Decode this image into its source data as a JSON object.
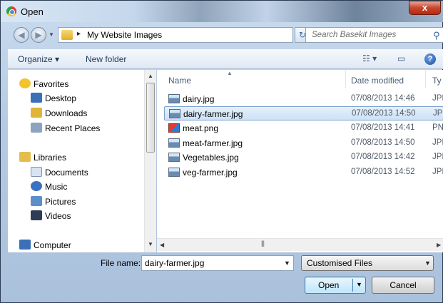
{
  "window": {
    "title": "Open",
    "close_glyph": "x"
  },
  "address": {
    "path_separator": "▸",
    "path": "My Website Images",
    "search_placeholder": "Search Basekit Images"
  },
  "toolbar": {
    "organize_label": "Organize ▾",
    "new_folder_label": "New folder",
    "views_glyph": "☷ ▾",
    "preview_glyph": "▭",
    "help_glyph": "?"
  },
  "nav": {
    "items": [
      {
        "label": "Favorites",
        "icon": "star-icon",
        "color": "#f3c22d"
      },
      {
        "label": "Desktop",
        "icon": "desktop-icon",
        "color": "#3b6fb6"
      },
      {
        "label": "Downloads",
        "icon": "downloads-icon",
        "color": "#e1b437"
      },
      {
        "label": "Recent Places",
        "icon": "recent-places-icon",
        "color": "#8ea3bd"
      },
      {
        "label": "Libraries",
        "icon": "libraries-icon",
        "color": "#e6bd4c"
      },
      {
        "label": "Documents",
        "icon": "documents-icon",
        "color": "#d9e4f1"
      },
      {
        "label": "Music",
        "icon": "music-icon",
        "color": "#3a71c1"
      },
      {
        "label": "Pictures",
        "icon": "pictures-icon",
        "color": "#5b8fc9"
      },
      {
        "label": "Videos",
        "icon": "videos-icon",
        "color": "#2e3d55"
      },
      {
        "label": "Computer",
        "icon": "computer-icon",
        "color": "#3b6fb6"
      }
    ]
  },
  "files": {
    "columns": {
      "name": "Name",
      "date": "Date modified",
      "type": "Ty"
    },
    "rows": [
      {
        "name": "dairy.jpg",
        "date": "07/08/2013 14:46",
        "type": "JPI"
      },
      {
        "name": "dairy-farmer.jpg",
        "date": "07/08/2013 14:50",
        "type": "JPI"
      },
      {
        "name": "meat.png",
        "date": "07/08/2013 14:41",
        "type": "PN"
      },
      {
        "name": "meat-farmer.jpg",
        "date": "07/08/2013 14:50",
        "type": "JPI"
      },
      {
        "name": "Vegetables.jpg",
        "date": "07/08/2013 14:42",
        "type": "JPI"
      },
      {
        "name": "veg-farmer.jpg",
        "date": "07/08/2013 14:52",
        "type": "JPI"
      }
    ],
    "selected_index": 1
  },
  "bottom": {
    "file_name_label": "File name:",
    "file_name_value": "dairy-farmer.jpg",
    "file_type_value": "Customised Files",
    "open_label": "Open",
    "cancel_label": "Cancel"
  },
  "colors": {
    "accent": "#3c7fb1",
    "selection": "#cde1f7"
  }
}
